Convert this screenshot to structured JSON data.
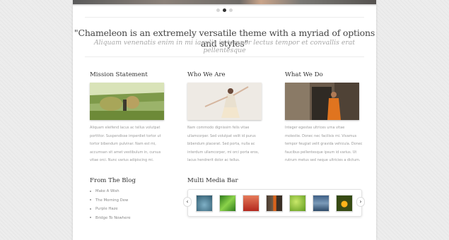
{
  "slider": {
    "dots": 3,
    "active_dot": 1
  },
  "intro": {
    "quote": "\"Chameleon is an extremely versatile theme with a myriad of options and styles\"",
    "subquote": "Aliquam venenatis enim in mi iaculis in tempor lectus tempor et convallis erat pellentesque"
  },
  "columns": [
    {
      "title": "Mission Statement",
      "lines": [
        "Aliquam eleifend lacus ac tellus volutpat",
        "porttitor. Suspendisse imperdiet tortor ut",
        "tortor bibendum pulvinar. Nam est mi,",
        "accumsan sit amet vestibulum in, cursus",
        "vitae orci. Nunc varius adipiscing mi."
      ],
      "image": "field-workers"
    },
    {
      "title": "Who We Are",
      "lines": [
        "Nam commodo dignissim felis vitae",
        "ullamcorper. Sed volutpat velit id purus",
        "bibendum placerat. Sed porta, nulla ac",
        "interdum ullamcorper, mi orci porta eros,",
        "lacus hendrerit dolor ac tellus."
      ],
      "image": "dancing-woman"
    },
    {
      "title": "What We Do",
      "lines": [
        "Integer egestas ultrices urna vitae",
        "molestie. Donec nec facilisis mi. Vivamus",
        "tempor feugiat velit gravida vehicula. Donec",
        "faucibus pellentesque ipsum id varius. Ut",
        "rutrum metus sed neque ultricies a dictum."
      ],
      "image": "monk-temple"
    }
  ],
  "blog": {
    "title": "From The Blog",
    "items": [
      "Make A Wish",
      "The Morning Dew",
      "Purple Haze",
      "Bridge To Nowhere"
    ]
  },
  "media": {
    "title": "Multi Media Bar",
    "prev": "‹",
    "next": "›",
    "thumbs": [
      "pond-icon",
      "leaf-icon",
      "red-forest-icon",
      "monk-icon",
      "green-sprout-icon",
      "waterfall-icon",
      "toucan-icon"
    ]
  }
}
